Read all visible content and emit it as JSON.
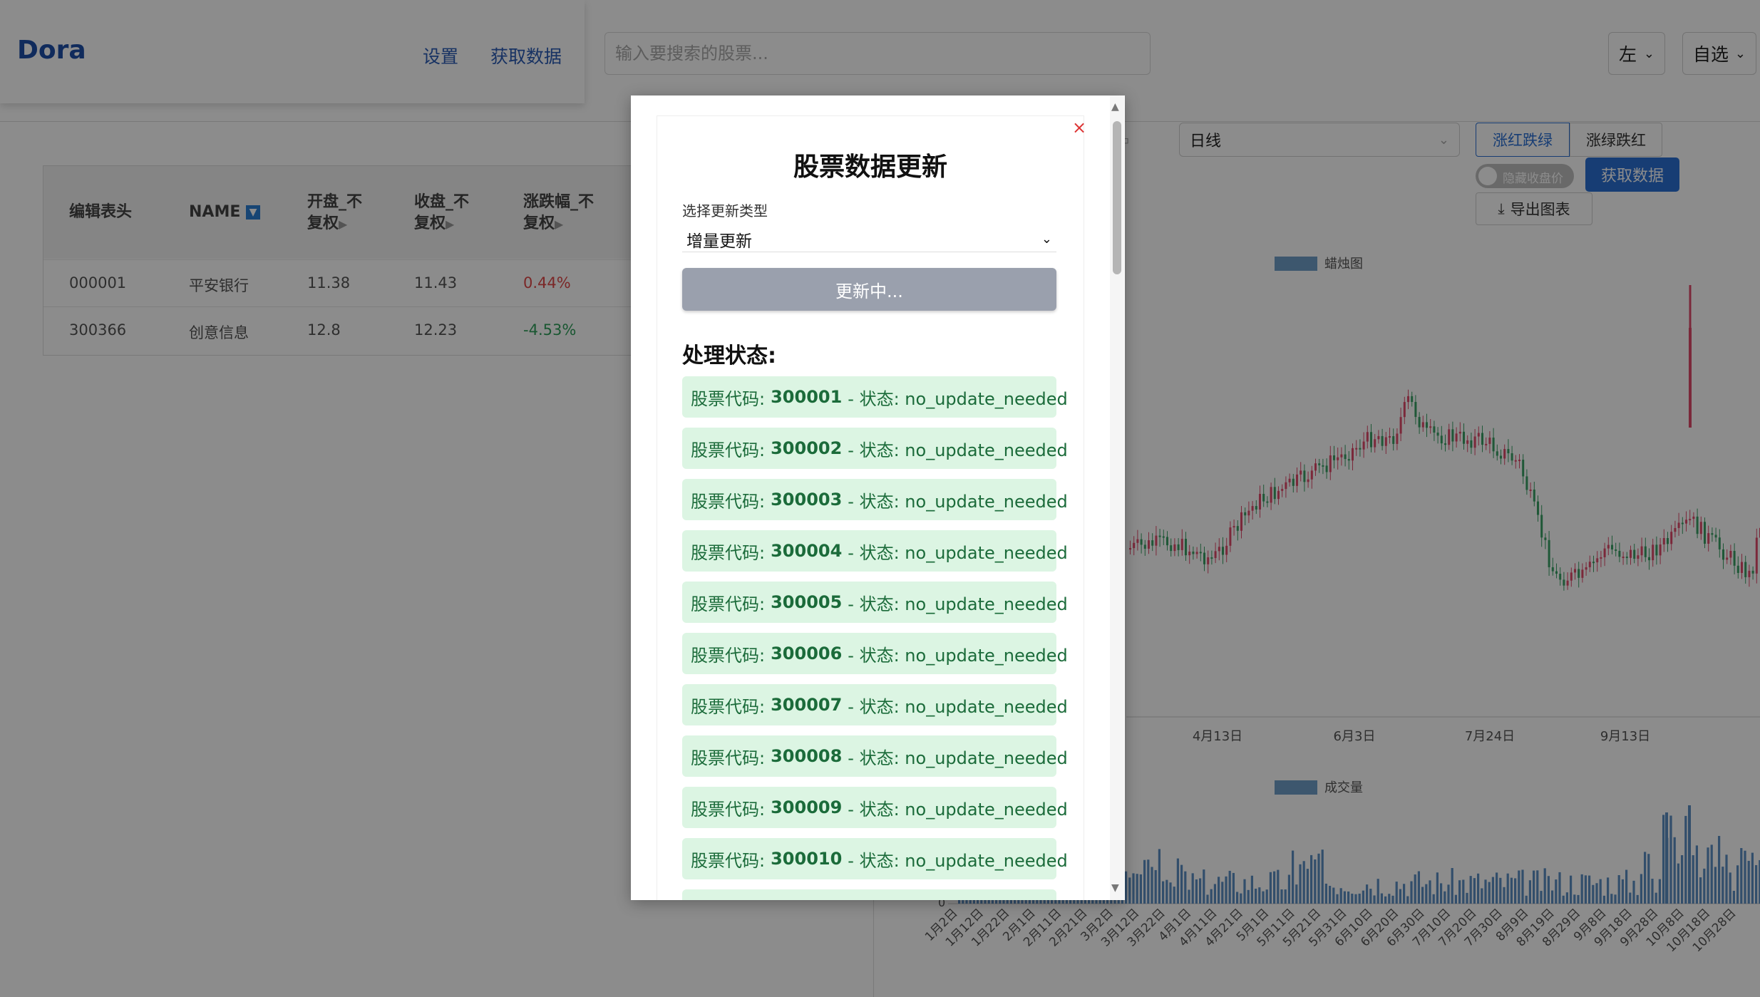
{
  "header": {
    "brand": "Dora",
    "nav": [
      "设置",
      "获取数据"
    ],
    "search_placeholder": "输入要搜索的股票...",
    "side_select": "左",
    "list_select": "自选"
  },
  "table": {
    "headers": [
      "编辑表头",
      "NAME",
      "开盘_不复权",
      "收盘_不复权",
      "涨跌幅_不复权"
    ],
    "rows": [
      {
        "code": "000001",
        "name": "平安银行",
        "open": "11.38",
        "close": "11.43",
        "change": "0.44%"
      },
      {
        "code": "300366",
        "name": "创意信息",
        "open": "12.8",
        "close": "12.23",
        "change": "-4.53%"
      }
    ]
  },
  "chart_controls": {
    "period": "日线",
    "color_mode_active": "涨红跌绿",
    "color_mode_other": "涨绿跌红",
    "hide_close_label": "隐藏收盘价",
    "fetch_button": "获取数据",
    "export_button": "导出图表"
  },
  "chart_data": [
    {
      "type": "candlestick",
      "legend": "蜡烛图",
      "x_tick_labels": [
        "4月13日",
        "6月3日",
        "7月24日",
        "9月13日"
      ]
    },
    {
      "type": "bar",
      "legend": "成交量",
      "y_tick_labels": [
        "0"
      ],
      "x_tick_labels": [
        "1月2日",
        "1月12日",
        "1月22日",
        "2月1日",
        "2月11日",
        "2月21日",
        "3月2日",
        "3月12日",
        "3月22日",
        "4月1日",
        "4月11日",
        "4月21日",
        "5月1日",
        "5月11日",
        "5月21日",
        "5月31日",
        "6月10日",
        "6月20日",
        "6月30日",
        "7月10日",
        "7月20日",
        "7月30日",
        "8月9日",
        "8月19日",
        "8月29日",
        "9月8日",
        "9月18日",
        "9月28日",
        "10月8日",
        "10月18日",
        "10月28日"
      ]
    }
  ],
  "modal": {
    "close": "×",
    "title": "股票数据更新",
    "type_label": "选择更新类型",
    "type_value": "增量更新",
    "button": "更新中...",
    "status_title": "处理状态:",
    "status_prefix": "股票代码:",
    "status_mid": "- 状态: no_update_needed",
    "codes": [
      "300001",
      "300002",
      "300003",
      "300004",
      "300005",
      "300006",
      "300007",
      "300008",
      "300009",
      "300010"
    ]
  }
}
